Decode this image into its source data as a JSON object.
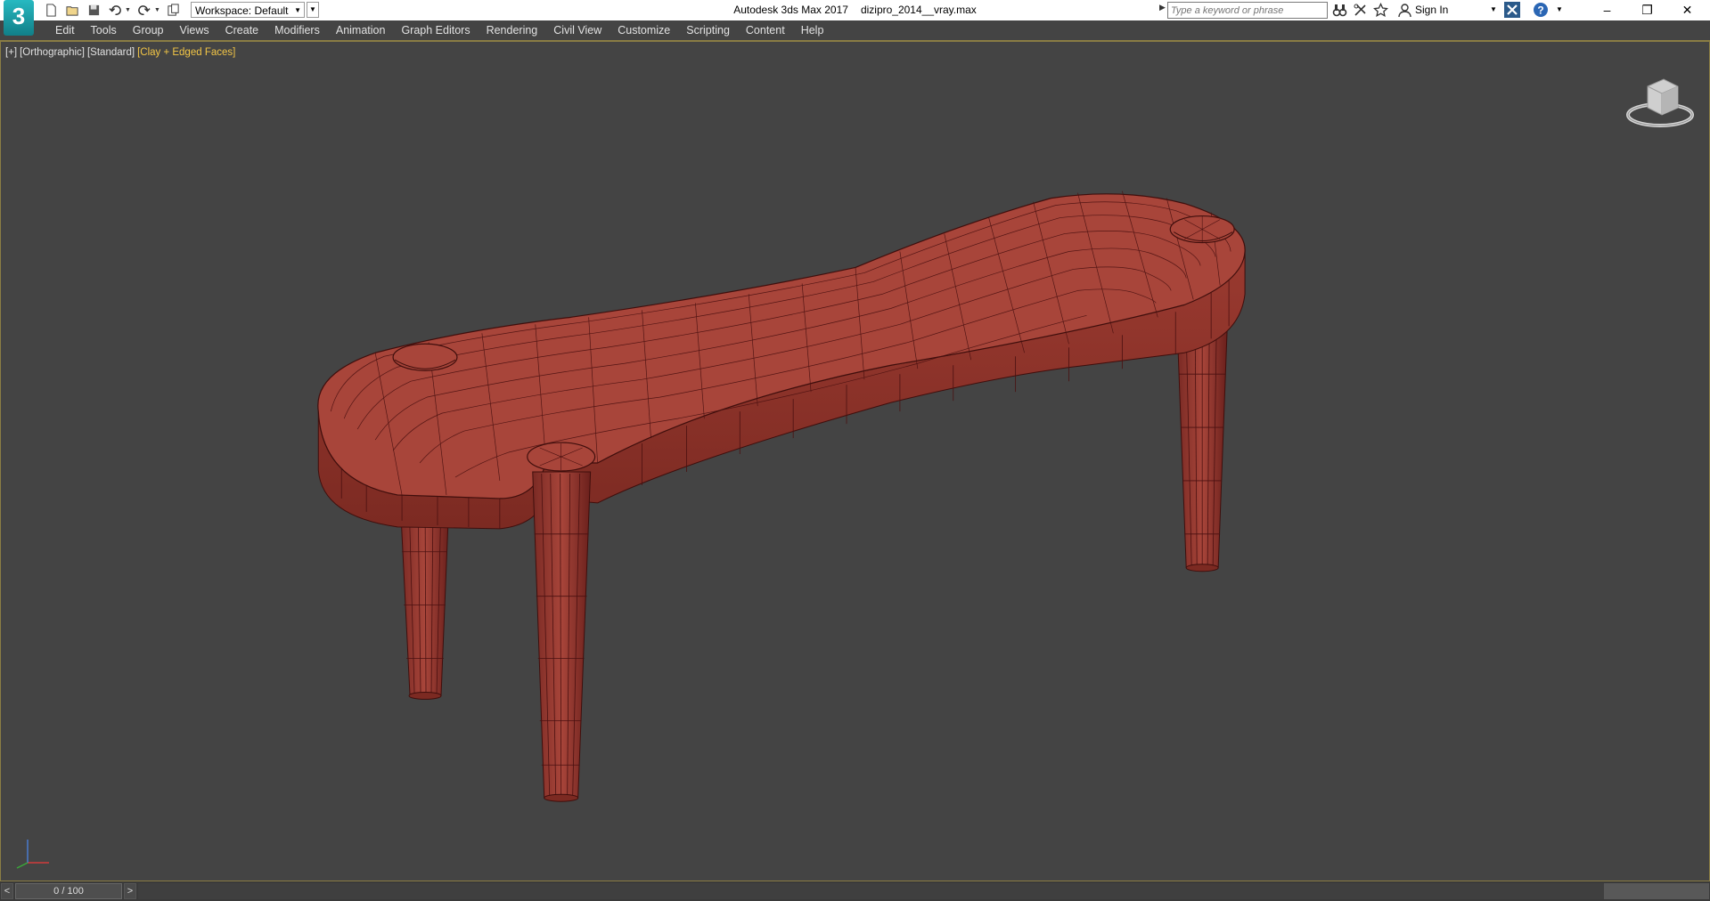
{
  "app": {
    "logo": "3",
    "title": "Autodesk 3ds Max 2017",
    "filename": "dizipro_2014__vray.max"
  },
  "toolbar": {
    "workspace_label": "Workspace: Default"
  },
  "search": {
    "placeholder": "Type a keyword or phrase"
  },
  "account": {
    "sign_in_label": "Sign In"
  },
  "window_controls": {
    "minimize": "–",
    "maximize": "❐",
    "close": "✕"
  },
  "menu": {
    "items": [
      "Edit",
      "Tools",
      "Group",
      "Views",
      "Create",
      "Modifiers",
      "Animation",
      "Graph Editors",
      "Rendering",
      "Civil View",
      "Customize",
      "Scripting",
      "Content",
      "Help"
    ]
  },
  "viewport": {
    "label_plus": "[+]",
    "label_view": "[Orthographic]",
    "label_shading": "[Standard]",
    "label_style": "[Clay + Edged Faces]"
  },
  "timeline": {
    "prev": "<",
    "frame": "0 / 100",
    "next": ">"
  },
  "colors": {
    "model_fill": "#a8453a",
    "model_edge": "#4a1010",
    "viewport_bg": "#444444",
    "highlight": "#f3c646"
  }
}
